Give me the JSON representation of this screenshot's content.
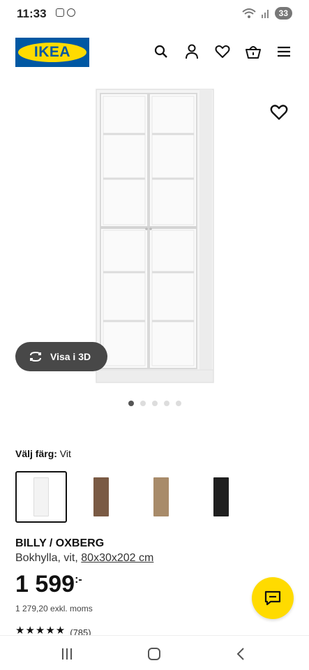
{
  "status_bar": {
    "time": "11:33",
    "battery": "33"
  },
  "header": {
    "logo_text": "IKEA",
    "icons": [
      "search-icon",
      "account-icon",
      "heart-icon",
      "basket-icon",
      "menu-icon"
    ]
  },
  "gallery": {
    "view_3d_label": "Visa i 3D",
    "dots_count": 5,
    "active_dot": 0
  },
  "color_picker": {
    "label": "Välj färg:",
    "selected_value": "Vit",
    "swatches": [
      {
        "name": "white",
        "color": "#f3f3f3"
      },
      {
        "name": "walnut",
        "color": "#7a5a44"
      },
      {
        "name": "oak",
        "color": "#a88b6a"
      },
      {
        "name": "black-brown",
        "color": "#1f1f1f"
      }
    ]
  },
  "product": {
    "name": "BILLY / OXBERG",
    "description": "Bokhylla, vit,",
    "dimensions": "80x30x202 cm",
    "price": "1 599",
    "price_suffix": ":-",
    "price_ex_vat": "1 279,20 exkl. moms",
    "rating_stars": "★★★★★",
    "rating_count": "(785)"
  },
  "colors": {
    "ikea_blue": "#0058a3",
    "ikea_yellow": "#ffdb00",
    "pill_dark": "#484848"
  }
}
